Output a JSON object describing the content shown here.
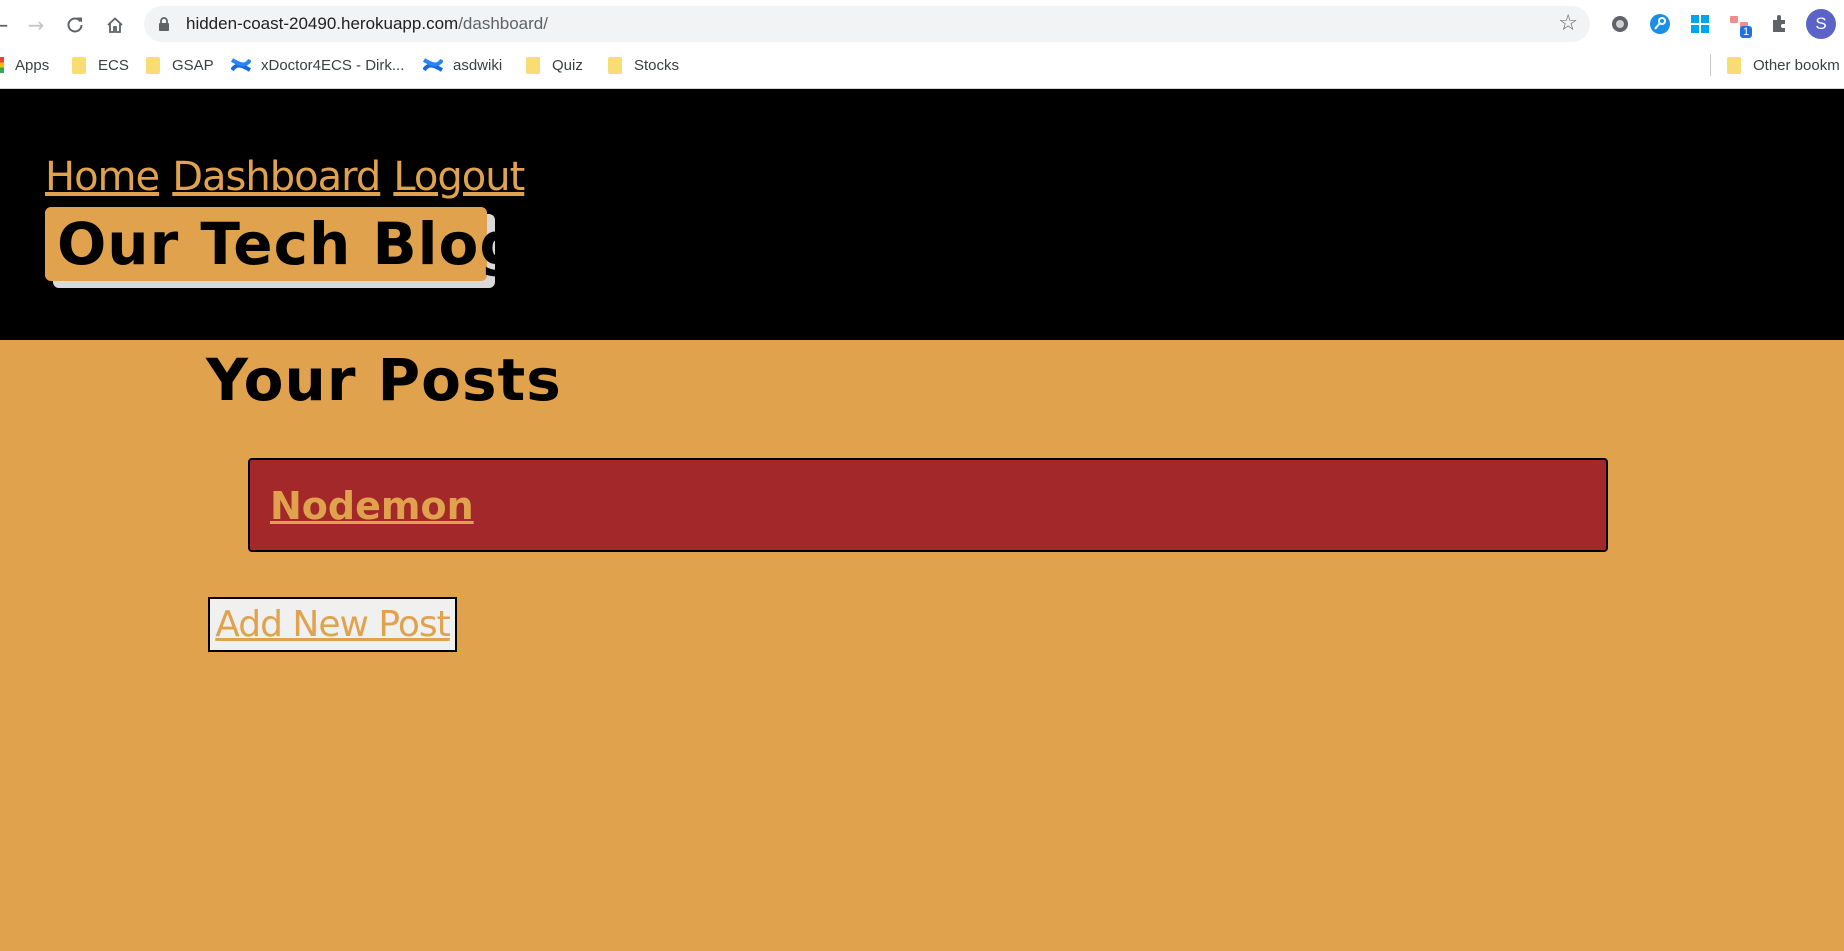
{
  "browser": {
    "url_host": "hidden-coast-20490.herokuapp.com",
    "url_path": "/dashboard/",
    "extension_badge": "1",
    "profile_initial": "S",
    "bookmarks": [
      {
        "label": "Apps",
        "icon": "apps-grid-icon"
      },
      {
        "label": "ECS",
        "icon": "folder-icon"
      },
      {
        "label": "GSAP",
        "icon": "folder-icon"
      },
      {
        "label": "xDoctor4ECS - Dirk...",
        "icon": "confluence-icon"
      },
      {
        "label": "asdwiki",
        "icon": "confluence-icon"
      },
      {
        "label": "Quiz",
        "icon": "folder-icon"
      },
      {
        "label": "Stocks",
        "icon": "folder-icon"
      }
    ],
    "other_bookmarks": "Other bookm"
  },
  "site": {
    "nav": {
      "home": "Home",
      "dashboard": "Dashboard",
      "logout": "Logout"
    },
    "brand": "Our Tech Blog"
  },
  "dashboard": {
    "title": "Your Posts",
    "posts": [
      {
        "title": "Nodemon"
      }
    ],
    "add_button": "Add New Post"
  },
  "colors": {
    "page_background": "#e0a24c",
    "header_background": "#000000",
    "post_card": "#a3282a",
    "accent_text": "#e0a24c"
  }
}
